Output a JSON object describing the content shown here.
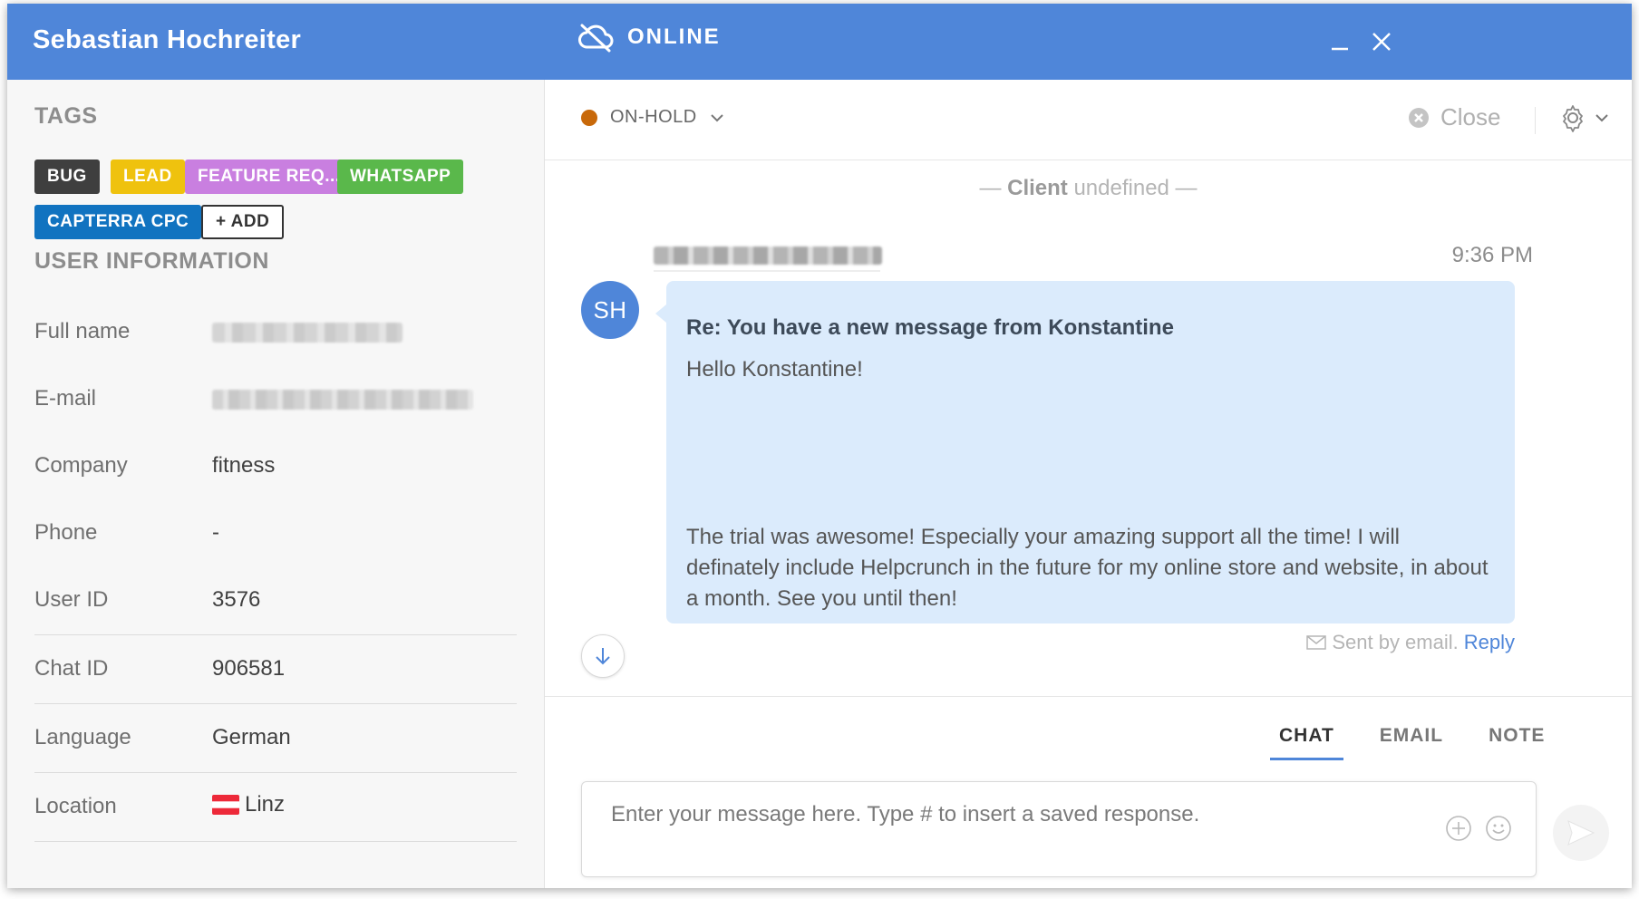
{
  "header": {
    "user_name": "Sebastian Hochreiter",
    "connection_status": "ONLINE",
    "icons": [
      "cloud-offline-icon",
      "minimize-icon",
      "close-icon"
    ]
  },
  "sidebar": {
    "tags_title": "TAGS",
    "tags": [
      {
        "label": "BUG",
        "color": "#3f3f3f"
      },
      {
        "label": "LEAD",
        "color": "#efc20e"
      },
      {
        "label": "FEATURE REQ...",
        "color": "#c97fe0"
      },
      {
        "label": "WHATSAPP",
        "color": "#5ab84b"
      },
      {
        "label": "CAPTERRA CPC",
        "color": "#1173c0"
      }
    ],
    "add_tag_label": "+ ADD",
    "user_info_title": "USER INFORMATION",
    "fields": [
      {
        "label": "Full name",
        "value": ""
      },
      {
        "label": "E-mail",
        "value": ""
      },
      {
        "label": "Company",
        "value": "fitness"
      },
      {
        "label": "Phone",
        "value": "-"
      },
      {
        "label": "User ID",
        "value": "3576"
      },
      {
        "label": "Chat ID",
        "value": "906581"
      },
      {
        "label": "Language",
        "value": "German"
      },
      {
        "label": "Location",
        "value": "Linz"
      }
    ]
  },
  "chat": {
    "status": "ON-HOLD",
    "status_color": "#c8690a",
    "close_label": "Close",
    "client_prefix": "— ",
    "client_label": "Client",
    "client_value": " undefined —",
    "message": {
      "time": "9:36 PM",
      "avatar_initials": "SH",
      "subject": "Re: You have a new message from Konstantine",
      "greeting": "Hello Konstantine!",
      "body": "The trial was awesome! Especially your amazing support all the time! I will definately include Helpcrunch in the future for my online store and website, in about a month. See you until then!",
      "sent_by": "Sent by email.",
      "reply_label": "Reply"
    },
    "tabs": [
      "CHAT",
      "EMAIL",
      "NOTE"
    ],
    "active_tab": "CHAT",
    "input_placeholder": "Enter your message here. Type # to insert a saved response."
  }
}
